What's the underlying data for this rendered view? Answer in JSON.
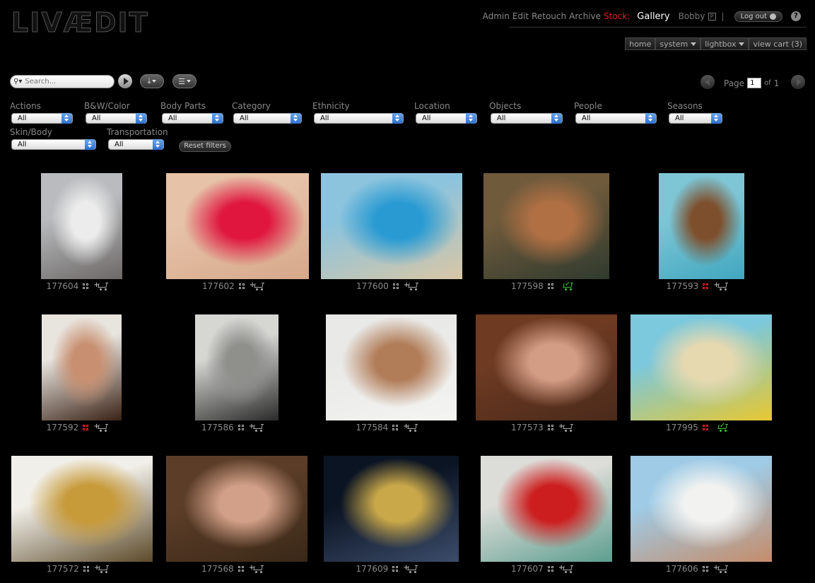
{
  "logo": "LIVÆDIT",
  "nav": {
    "links": [
      "Admin",
      "Edit",
      "Retouch",
      "Archive"
    ],
    "stock": "Stock:",
    "gallery": "Gallery",
    "user": "Bobby",
    "user_badge": "P",
    "separator": "|",
    "logout": "Log out",
    "help": "?"
  },
  "tabs": [
    {
      "label": "home",
      "dropdown": false
    },
    {
      "label": "system",
      "dropdown": true
    },
    {
      "label": "lightbox",
      "dropdown": true
    },
    {
      "label": "view cart (3)",
      "dropdown": false
    }
  ],
  "search": {
    "placeholder": "Search..."
  },
  "pager": {
    "label": "Page",
    "current": "1",
    "of_label": "of",
    "total": "1"
  },
  "filters": [
    {
      "label": "Actions",
      "value": "All"
    },
    {
      "label": "B&W/Color",
      "value": "All"
    },
    {
      "label": "Body Parts",
      "value": "All"
    },
    {
      "label": "Category",
      "value": "All"
    },
    {
      "label": "Ethnicity",
      "value": "All"
    },
    {
      "label": "Location",
      "value": "All"
    },
    {
      "label": "Objects",
      "value": "All"
    },
    {
      "label": "People",
      "value": "All"
    },
    {
      "label": "Seasons",
      "value": "All"
    },
    {
      "label": "Skin/Body",
      "value": "All"
    },
    {
      "label": "Transportation",
      "value": "All"
    }
  ],
  "reset_label": "Reset filters",
  "images": [
    {
      "id": "177604",
      "in_lightbox": false,
      "in_cart": false,
      "colors": [
        "#b9bbbe",
        "#ececec",
        "#6c6866"
      ]
    },
    {
      "id": "177602",
      "in_lightbox": false,
      "in_cart": false,
      "colors": [
        "#e6c2a8",
        "#e0163f",
        "#d6a88a"
      ]
    },
    {
      "id": "177600",
      "in_lightbox": false,
      "in_cart": false,
      "colors": [
        "#8dc4dd",
        "#2a9bd2",
        "#d9c6a6"
      ]
    },
    {
      "id": "177598",
      "in_lightbox": false,
      "in_cart": true,
      "colors": [
        "#6f5a3c",
        "#b07044",
        "#2f3a2e"
      ]
    },
    {
      "id": "177593",
      "in_lightbox": true,
      "in_cart": false,
      "colors": [
        "#7ec6d6",
        "#7e4f2c",
        "#41a7bf"
      ]
    },
    {
      "id": "177592",
      "in_lightbox": true,
      "in_cart": false,
      "colors": [
        "#e8e4de",
        "#c89071",
        "#3a2216"
      ]
    },
    {
      "id": "177586",
      "in_lightbox": false,
      "in_cart": false,
      "colors": [
        "#d6d6d3",
        "#8f8f8c",
        "#2a2a2a"
      ]
    },
    {
      "id": "177584",
      "in_lightbox": false,
      "in_cart": false,
      "colors": [
        "#e9e9e7",
        "#b17c58",
        "#f4f4f2"
      ]
    },
    {
      "id": "177573",
      "in_lightbox": false,
      "in_cart": false,
      "colors": [
        "#6e3a22",
        "#d39c84",
        "#4a2a1b"
      ]
    },
    {
      "id": "177995",
      "in_lightbox": true,
      "in_cart": true,
      "colors": [
        "#7cc8dc",
        "#e6d9b0",
        "#e8c830"
      ]
    },
    {
      "id": "177572",
      "in_lightbox": false,
      "in_cart": false,
      "colors": [
        "#f1efe9",
        "#c79a3a",
        "#5c4a2a"
      ]
    },
    {
      "id": "177568",
      "in_lightbox": false,
      "in_cart": false,
      "colors": [
        "#5c3e28",
        "#d2a088",
        "#3a2818"
      ]
    },
    {
      "id": "177609",
      "in_lightbox": false,
      "in_cart": false,
      "colors": [
        "#0b1423",
        "#c9a84a",
        "#3c4c6a"
      ]
    },
    {
      "id": "177607",
      "in_lightbox": false,
      "in_cart": false,
      "colors": [
        "#dcdcd8",
        "#cc1e1e",
        "#5d9e8f"
      ]
    },
    {
      "id": "177606",
      "in_lightbox": false,
      "in_cart": false,
      "colors": [
        "#9fcbe6",
        "#f2f2f0",
        "#c58c6a"
      ]
    }
  ]
}
